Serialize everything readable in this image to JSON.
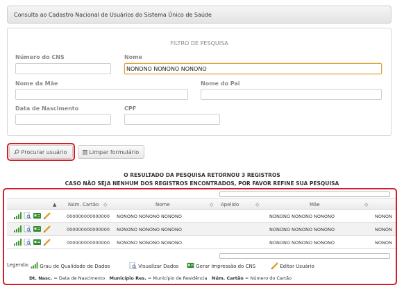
{
  "header": {
    "title": "Consulta ao Cadastro Nacional de Usuários do Sistema Único de Saúde"
  },
  "filter": {
    "title": "FILTRO DE PESQUISA",
    "labels": {
      "cns": "Número do CNS",
      "nome": "Nome",
      "mae": "Nome da Mãe",
      "pai": "Nome do Pai",
      "nascimento": "Data de Nascimento",
      "cpf": "CPF"
    },
    "values": {
      "cns": "",
      "nome": "NONONO NONONO NONONO",
      "mae": "",
      "pai": "",
      "nascimento": "",
      "cpf": ""
    }
  },
  "buttons": {
    "search": "Procurar usuário",
    "clear": "Limpar formulário"
  },
  "result": {
    "line1": "O RESULTADO DA PESQUISA RETORNOU 3 REGISTROS",
    "line2": "CASO NÃO SEJA NENHUM DOS REGISTROS ENCONTRADOS, POR FAVOR REFINE SUA PESQUISA"
  },
  "table": {
    "columns": [
      "Núm. Cartão",
      "Nome",
      "Apelido",
      "Mãe"
    ],
    "sort_glyph": "◇",
    "rows": [
      {
        "cartao": "000000000000000",
        "nome": "NONONO NONONO NONONO",
        "apelido": "",
        "mae": "NONONO NONONO NONONO",
        "extra": "NONON"
      },
      {
        "cartao": "000000000000000",
        "nome": "NONONO NONONO NONONO",
        "apelido": "",
        "mae": "NONONO NONONO NONONO",
        "extra": "NONON"
      },
      {
        "cartao": "000000000000000",
        "nome": "NONONO NONONO NONONO",
        "apelido": "",
        "mae": "NONONO NONONO NONONO",
        "extra": "NONON"
      }
    ]
  },
  "legend": {
    "label": "Legenda:",
    "grau": "Grau de Qualidade de Dados",
    "visualizar": "Visualizar Dados",
    "impressao": "Gerar Impressão do CNS",
    "editar": "Editar Usuário",
    "nasc_key": "Dt. Nasc.",
    "nasc_val": "= Data de Nascimento",
    "mun_key": "Município Res.",
    "mun_val": "= Município de Residência",
    "cartao_key": "Núm. Cartão",
    "cartao_val": "= Número do Cartão"
  },
  "colors": {
    "highlight": "#d2202a",
    "focus": "#d9a53c",
    "signal_green": "#3a9a2a"
  }
}
